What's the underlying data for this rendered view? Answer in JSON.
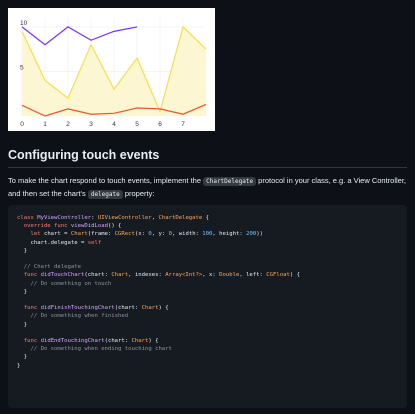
{
  "chart_data": {
    "type": "line",
    "x": [
      0,
      1,
      2,
      3,
      4,
      5,
      6,
      7,
      8
    ],
    "xticks": [
      "0",
      "1",
      "2",
      "3",
      "4",
      "5",
      "6",
      "7"
    ],
    "yticks": [
      "10",
      "5"
    ],
    "ylim": [
      0,
      11
    ],
    "xlim": [
      0,
      8
    ],
    "grid": true,
    "series": [
      {
        "color": "#7b2ff7",
        "values": [
          10,
          8,
          10,
          8.5,
          9.5,
          10,
          null,
          null,
          null
        ]
      },
      {
        "color": "#f3e04a",
        "fill": "#fdf6d3",
        "values": [
          9.5,
          4,
          2,
          8,
          3,
          6.5,
          0.5,
          10,
          7.5
        ]
      },
      {
        "color": "#e4572e",
        "values": [
          1.2,
          0,
          0.8,
          0.2,
          0.3,
          0.9,
          0.8,
          0.2,
          1.3
        ]
      }
    ]
  },
  "doc": {
    "heading": "Configuring touch events",
    "para_1": "To make the chart respond to touch events, implement the ",
    "code_1": "ChartDelegate",
    "para_2": " protocol in your class, e.g. a View Controller, and then set the chart's ",
    "code_2": "delegate",
    "para_3": " property:"
  },
  "code": {
    "l1": {
      "k": "class",
      "n": " MyViewController",
      "p": ": ",
      "t1": "UIViewController",
      "c": ", ",
      "t2": "ChartDelegate",
      "e": " {"
    },
    "l2": {
      "k": "  override func",
      "f": " viewDidLoad",
      "e": "() {"
    },
    "l3": {
      "k": "    let",
      "a": " chart = ",
      "t": "Chart",
      "b": "(frame: ",
      "t2": "CGRect",
      "c": "(x: ",
      "n1": "0",
      "d": ", y: ",
      "n2": "0",
      "e": ", width: ",
      "n3": "100",
      "f": ", height: ",
      "n4": "200",
      "g": "))"
    },
    "l4": {
      "a": "    chart.delegate = ",
      "k": "self"
    },
    "l5": "  }",
    "l7": "  // Chart delegate",
    "l8": {
      "k": "  func",
      "f": " didTouchChart",
      "a": "(chart: ",
      "t": "Chart",
      "b": ", indexes: ",
      "t2": "Array<Int?>",
      "c": ", x: ",
      "t3": "Double",
      "d": ", left: ",
      "t4": "CGFloat",
      "e": ") {"
    },
    "l9": "    // Do something on touch",
    "l10": "  }",
    "l12": {
      "k": "  func",
      "f": " didFinishTouchingChart",
      "a": "(chart: ",
      "t": "Chart",
      "e": ") {"
    },
    "l13": "    // Do something when finished",
    "l14": "  }",
    "l16": {
      "k": "  func",
      "f": " didEndTouchingChart",
      "a": "(chart: ",
      "t": "Chart",
      "e": ") {"
    },
    "l17": "    // Do something when ending touching chart",
    "l18": "  }",
    "l19": "}"
  }
}
